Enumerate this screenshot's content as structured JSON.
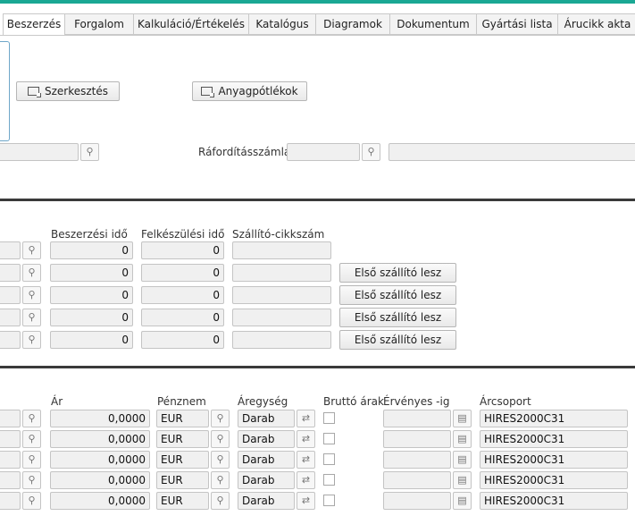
{
  "tabs": [
    {
      "label": "Beszerzés",
      "active": true
    },
    {
      "label": "Forgalom"
    },
    {
      "label": "Kalkuláció/Értékelés"
    },
    {
      "label": "Katalógus"
    },
    {
      "label": "Diagramok"
    },
    {
      "label": "Dokumentum"
    },
    {
      "label": "Gyártási lista"
    },
    {
      "label": "Árucikk akta"
    }
  ],
  "buttons": {
    "edit": "Szerkesztés",
    "substitutes": "Anyagpótlékok"
  },
  "expense_account": {
    "label": "Ráfordításszámla"
  },
  "suppliers": {
    "headers": {
      "lead_time": "Beszerzési idő",
      "prep_time": "Felkészülési idő",
      "supplier_item_no": "Szállító-cikkszám"
    },
    "first_supplier_label": "Első szállító lesz",
    "rows": [
      {
        "lead_time": "0",
        "prep_time": "0",
        "supplier_item_no": "",
        "has_button": false
      },
      {
        "lead_time": "0",
        "prep_time": "0",
        "supplier_item_no": "",
        "has_button": true
      },
      {
        "lead_time": "0",
        "prep_time": "0",
        "supplier_item_no": "",
        "has_button": true
      },
      {
        "lead_time": "0",
        "prep_time": "0",
        "supplier_item_no": "",
        "has_button": true
      },
      {
        "lead_time": "0",
        "prep_time": "0",
        "supplier_item_no": "",
        "has_button": true
      }
    ]
  },
  "prices": {
    "headers": {
      "price": "Ár",
      "currency": "Pénznem",
      "unit": "Áregység",
      "gross": "Bruttó árak",
      "valid_to": "Érvényes -ig",
      "price_group": "Árcsoport"
    },
    "rows": [
      {
        "price": "0,0000",
        "currency": "EUR",
        "unit": "Darab",
        "gross": false,
        "valid_to": "",
        "price_group": "HIRES2000C31"
      },
      {
        "price": "0,0000",
        "currency": "EUR",
        "unit": "Darab",
        "gross": false,
        "valid_to": "",
        "price_group": "HIRES2000C31"
      },
      {
        "price": "0,0000",
        "currency": "EUR",
        "unit": "Darab",
        "gross": false,
        "valid_to": "",
        "price_group": "HIRES2000C31"
      },
      {
        "price": "0,0000",
        "currency": "EUR",
        "unit": "Darab",
        "gross": false,
        "valid_to": "",
        "price_group": "HIRES2000C31"
      },
      {
        "price": "0,0000",
        "currency": "EUR",
        "unit": "Darab",
        "gross": false,
        "valid_to": "",
        "price_group": "HIRES2000C31"
      }
    ]
  }
}
